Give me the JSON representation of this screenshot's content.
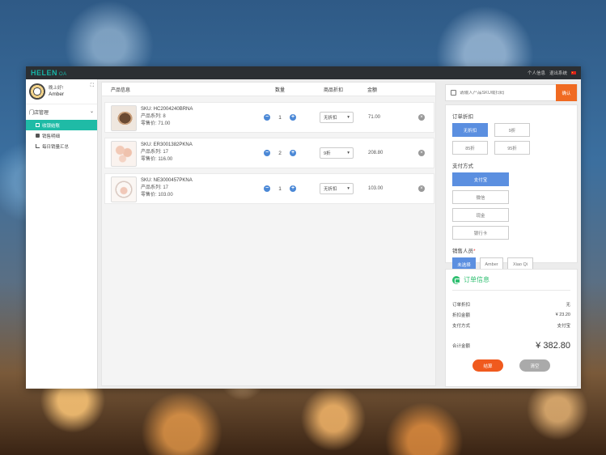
{
  "app": {
    "brand": "HELEN",
    "brand_sub": "OA"
  },
  "topnav": {
    "profile": "个人信息",
    "logout": "退出系统"
  },
  "user": {
    "greeting": "晚上好!",
    "name": "Amber"
  },
  "sidebar": {
    "group": "门店管理",
    "items": [
      {
        "label": "收银结账",
        "active": true
      },
      {
        "label": "销售明细",
        "active": false
      },
      {
        "label": "每日销量汇总",
        "active": false
      }
    ]
  },
  "table": {
    "headers": {
      "product": "产品信息",
      "qty": "数量",
      "discount": "商品折扣",
      "amount": "金额"
    },
    "rows": [
      {
        "sku": "SKU: HC2004240BRNA",
        "series": "产品系列: 8",
        "retail": "零售价: 71.00",
        "qty": "1",
        "discount": "无折扣",
        "amount": "71.00"
      },
      {
        "sku": "SKU: ER3001382PKNA",
        "series": "产品系列: 17",
        "retail": "零售价: 116.00",
        "qty": "2",
        "discount": "9折",
        "amount": "208.80"
      },
      {
        "sku": "SKU: NE3000457PKNA",
        "series": "产品系列: 17",
        "retail": "零售价: 103.00",
        "qty": "1",
        "discount": "无折扣",
        "amount": "103.00"
      }
    ]
  },
  "search": {
    "placeholder": "请输入产品SKU或扫码",
    "confirm": "确认"
  },
  "options": {
    "discount_title": "订单折扣",
    "discounts": [
      {
        "label": "无折扣",
        "selected": true
      },
      {
        "label": "9折",
        "selected": false
      },
      {
        "label": "85折",
        "selected": false
      },
      {
        "label": "95折",
        "selected": false
      }
    ],
    "payment_title": "支付方式",
    "payments": [
      {
        "label": "支付宝",
        "selected": true
      },
      {
        "label": "微信",
        "selected": false
      },
      {
        "label": "现金",
        "selected": false
      },
      {
        "label": "银行卡",
        "selected": false
      }
    ],
    "staff_title": "销售人员",
    "staff_required": "*",
    "staff": [
      {
        "label": "未选择",
        "selected": true
      },
      {
        "label": "Amber",
        "selected": false
      },
      {
        "label": "Xiao Qi",
        "selected": false
      }
    ]
  },
  "order": {
    "title": "订单信息",
    "rows": [
      {
        "k": "订单折扣",
        "v": "无"
      },
      {
        "k": "折扣金额",
        "v": "¥ 23.20"
      },
      {
        "k": "支付方式",
        "v": "支付宝"
      }
    ],
    "total_label": "合计金额",
    "total_value": "¥ 382.80",
    "checkout": "结算",
    "clear": "清空"
  },
  "colors": {
    "accent": "#1fbba6",
    "primary": "#5b8fe0",
    "orange": "#f06a21",
    "success": "#2fbf71"
  }
}
